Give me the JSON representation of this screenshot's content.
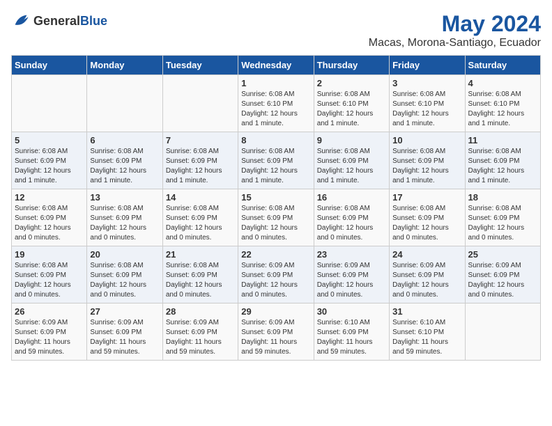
{
  "logo": {
    "general": "General",
    "blue": "Blue"
  },
  "title": "May 2024",
  "subtitle": "Macas, Morona-Santiago, Ecuador",
  "headers": [
    "Sunday",
    "Monday",
    "Tuesday",
    "Wednesday",
    "Thursday",
    "Friday",
    "Saturday"
  ],
  "weeks": [
    [
      {
        "day": "",
        "info": ""
      },
      {
        "day": "",
        "info": ""
      },
      {
        "day": "",
        "info": ""
      },
      {
        "day": "1",
        "info": "Sunrise: 6:08 AM\nSunset: 6:10 PM\nDaylight: 12 hours\nand 1 minute."
      },
      {
        "day": "2",
        "info": "Sunrise: 6:08 AM\nSunset: 6:10 PM\nDaylight: 12 hours\nand 1 minute."
      },
      {
        "day": "3",
        "info": "Sunrise: 6:08 AM\nSunset: 6:10 PM\nDaylight: 12 hours\nand 1 minute."
      },
      {
        "day": "4",
        "info": "Sunrise: 6:08 AM\nSunset: 6:10 PM\nDaylight: 12 hours\nand 1 minute."
      }
    ],
    [
      {
        "day": "5",
        "info": "Sunrise: 6:08 AM\nSunset: 6:09 PM\nDaylight: 12 hours\nand 1 minute."
      },
      {
        "day": "6",
        "info": "Sunrise: 6:08 AM\nSunset: 6:09 PM\nDaylight: 12 hours\nand 1 minute."
      },
      {
        "day": "7",
        "info": "Sunrise: 6:08 AM\nSunset: 6:09 PM\nDaylight: 12 hours\nand 1 minute."
      },
      {
        "day": "8",
        "info": "Sunrise: 6:08 AM\nSunset: 6:09 PM\nDaylight: 12 hours\nand 1 minute."
      },
      {
        "day": "9",
        "info": "Sunrise: 6:08 AM\nSunset: 6:09 PM\nDaylight: 12 hours\nand 1 minute."
      },
      {
        "day": "10",
        "info": "Sunrise: 6:08 AM\nSunset: 6:09 PM\nDaylight: 12 hours\nand 1 minute."
      },
      {
        "day": "11",
        "info": "Sunrise: 6:08 AM\nSunset: 6:09 PM\nDaylight: 12 hours\nand 1 minute."
      }
    ],
    [
      {
        "day": "12",
        "info": "Sunrise: 6:08 AM\nSunset: 6:09 PM\nDaylight: 12 hours\nand 0 minutes."
      },
      {
        "day": "13",
        "info": "Sunrise: 6:08 AM\nSunset: 6:09 PM\nDaylight: 12 hours\nand 0 minutes."
      },
      {
        "day": "14",
        "info": "Sunrise: 6:08 AM\nSunset: 6:09 PM\nDaylight: 12 hours\nand 0 minutes."
      },
      {
        "day": "15",
        "info": "Sunrise: 6:08 AM\nSunset: 6:09 PM\nDaylight: 12 hours\nand 0 minutes."
      },
      {
        "day": "16",
        "info": "Sunrise: 6:08 AM\nSunset: 6:09 PM\nDaylight: 12 hours\nand 0 minutes."
      },
      {
        "day": "17",
        "info": "Sunrise: 6:08 AM\nSunset: 6:09 PM\nDaylight: 12 hours\nand 0 minutes."
      },
      {
        "day": "18",
        "info": "Sunrise: 6:08 AM\nSunset: 6:09 PM\nDaylight: 12 hours\nand 0 minutes."
      }
    ],
    [
      {
        "day": "19",
        "info": "Sunrise: 6:08 AM\nSunset: 6:09 PM\nDaylight: 12 hours\nand 0 minutes."
      },
      {
        "day": "20",
        "info": "Sunrise: 6:08 AM\nSunset: 6:09 PM\nDaylight: 12 hours\nand 0 minutes."
      },
      {
        "day": "21",
        "info": "Sunrise: 6:08 AM\nSunset: 6:09 PM\nDaylight: 12 hours\nand 0 minutes."
      },
      {
        "day": "22",
        "info": "Sunrise: 6:09 AM\nSunset: 6:09 PM\nDaylight: 12 hours\nand 0 minutes."
      },
      {
        "day": "23",
        "info": "Sunrise: 6:09 AM\nSunset: 6:09 PM\nDaylight: 12 hours\nand 0 minutes."
      },
      {
        "day": "24",
        "info": "Sunrise: 6:09 AM\nSunset: 6:09 PM\nDaylight: 12 hours\nand 0 minutes."
      },
      {
        "day": "25",
        "info": "Sunrise: 6:09 AM\nSunset: 6:09 PM\nDaylight: 12 hours\nand 0 minutes."
      }
    ],
    [
      {
        "day": "26",
        "info": "Sunrise: 6:09 AM\nSunset: 6:09 PM\nDaylight: 11 hours\nand 59 minutes."
      },
      {
        "day": "27",
        "info": "Sunrise: 6:09 AM\nSunset: 6:09 PM\nDaylight: 11 hours\nand 59 minutes."
      },
      {
        "day": "28",
        "info": "Sunrise: 6:09 AM\nSunset: 6:09 PM\nDaylight: 11 hours\nand 59 minutes."
      },
      {
        "day": "29",
        "info": "Sunrise: 6:09 AM\nSunset: 6:09 PM\nDaylight: 11 hours\nand 59 minutes."
      },
      {
        "day": "30",
        "info": "Sunrise: 6:10 AM\nSunset: 6:09 PM\nDaylight: 11 hours\nand 59 minutes."
      },
      {
        "day": "31",
        "info": "Sunrise: 6:10 AM\nSunset: 6:10 PM\nDaylight: 11 hours\nand 59 minutes."
      },
      {
        "day": "",
        "info": ""
      }
    ]
  ],
  "colors": {
    "header_bg": "#1a56a0",
    "header_text": "#ffffff",
    "row_odd": "#f9f9f9",
    "row_even": "#eef2f8"
  }
}
